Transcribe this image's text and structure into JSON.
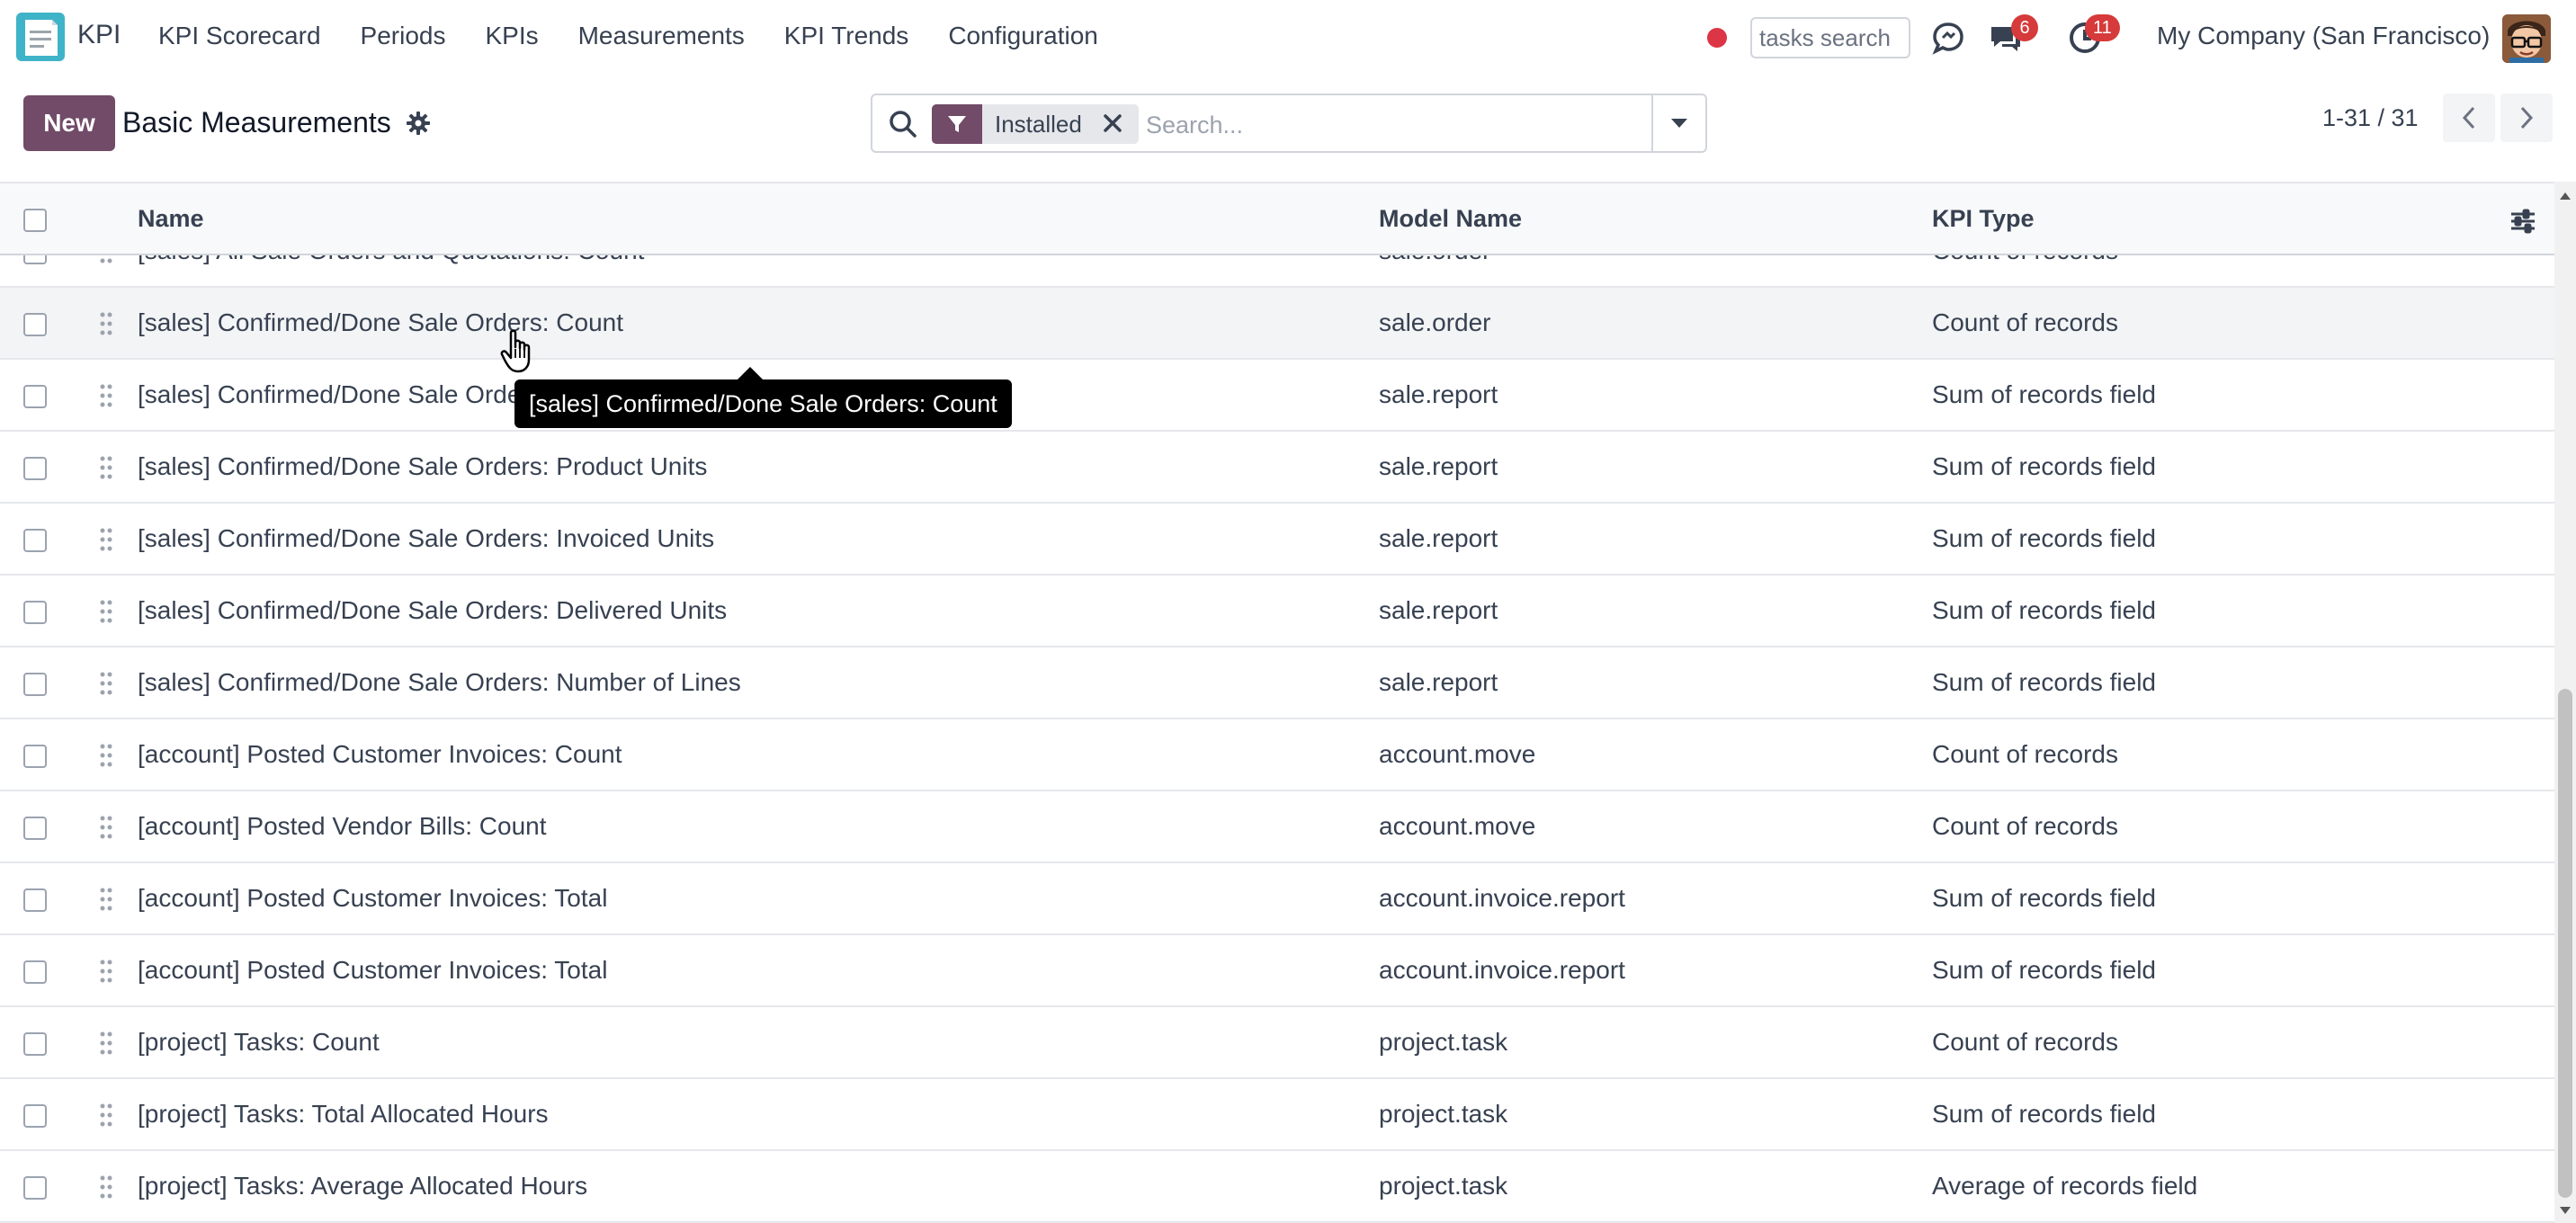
{
  "navbar": {
    "app_name": "KPI",
    "menu": [
      "KPI Scorecard",
      "Periods",
      "KPIs",
      "Measurements",
      "KPI Trends",
      "Configuration"
    ],
    "task_search_placeholder": "tasks search",
    "messages_badge": "6",
    "activities_badge": "11",
    "company": "My Company (San Francisco)"
  },
  "control_panel": {
    "new_label": "New",
    "title": "Basic Measurements",
    "facet_label": "Installed",
    "search_placeholder": "Search...",
    "pager": "1-31 / 31"
  },
  "list": {
    "columns": [
      "Name",
      "Model Name",
      "KPI Type"
    ],
    "rows": [
      {
        "name": "[sales] All Sale Orders and Quotations: Count",
        "model": "sale.order",
        "type": "Count of records"
      },
      {
        "name": "[sales] Confirmed/Done Sale Orders: Count",
        "model": "sale.order",
        "type": "Count of records"
      },
      {
        "name": "[sales] Confirmed/Done Sale Orders: Total",
        "model": "sale.report",
        "type": "Sum of records field"
      },
      {
        "name": "[sales] Confirmed/Done Sale Orders: Product Units",
        "model": "sale.report",
        "type": "Sum of records field"
      },
      {
        "name": "[sales] Confirmed/Done Sale Orders: Invoiced Units",
        "model": "sale.report",
        "type": "Sum of records field"
      },
      {
        "name": "[sales] Confirmed/Done Sale Orders: Delivered Units",
        "model": "sale.report",
        "type": "Sum of records field"
      },
      {
        "name": "[sales] Confirmed/Done Sale Orders: Number of Lines",
        "model": "sale.report",
        "type": "Sum of records field"
      },
      {
        "name": "[account] Posted Customer Invoices: Count",
        "model": "account.move",
        "type": "Count of records"
      },
      {
        "name": "[account] Posted Vendor Bills: Count",
        "model": "account.move",
        "type": "Count of records"
      },
      {
        "name": "[account] Posted Customer Invoices: Total",
        "model": "account.invoice.report",
        "type": "Sum of records field"
      },
      {
        "name": "[account] Posted Customer Invoices: Total",
        "model": "account.invoice.report",
        "type": "Sum of records field"
      },
      {
        "name": "[project] Tasks: Count",
        "model": "project.task",
        "type": "Count of records"
      },
      {
        "name": "[project] Tasks: Total Allocated Hours",
        "model": "project.task",
        "type": "Sum of records field"
      },
      {
        "name": "[project] Tasks: Average Allocated Hours",
        "model": "project.task",
        "type": "Average of records field"
      }
    ]
  },
  "tooltip": "[sales] Confirmed/Done Sale Orders: Count",
  "colors": {
    "brand": "#714b67",
    "badge": "#d63a3a",
    "record_dot": "#dc3545"
  }
}
